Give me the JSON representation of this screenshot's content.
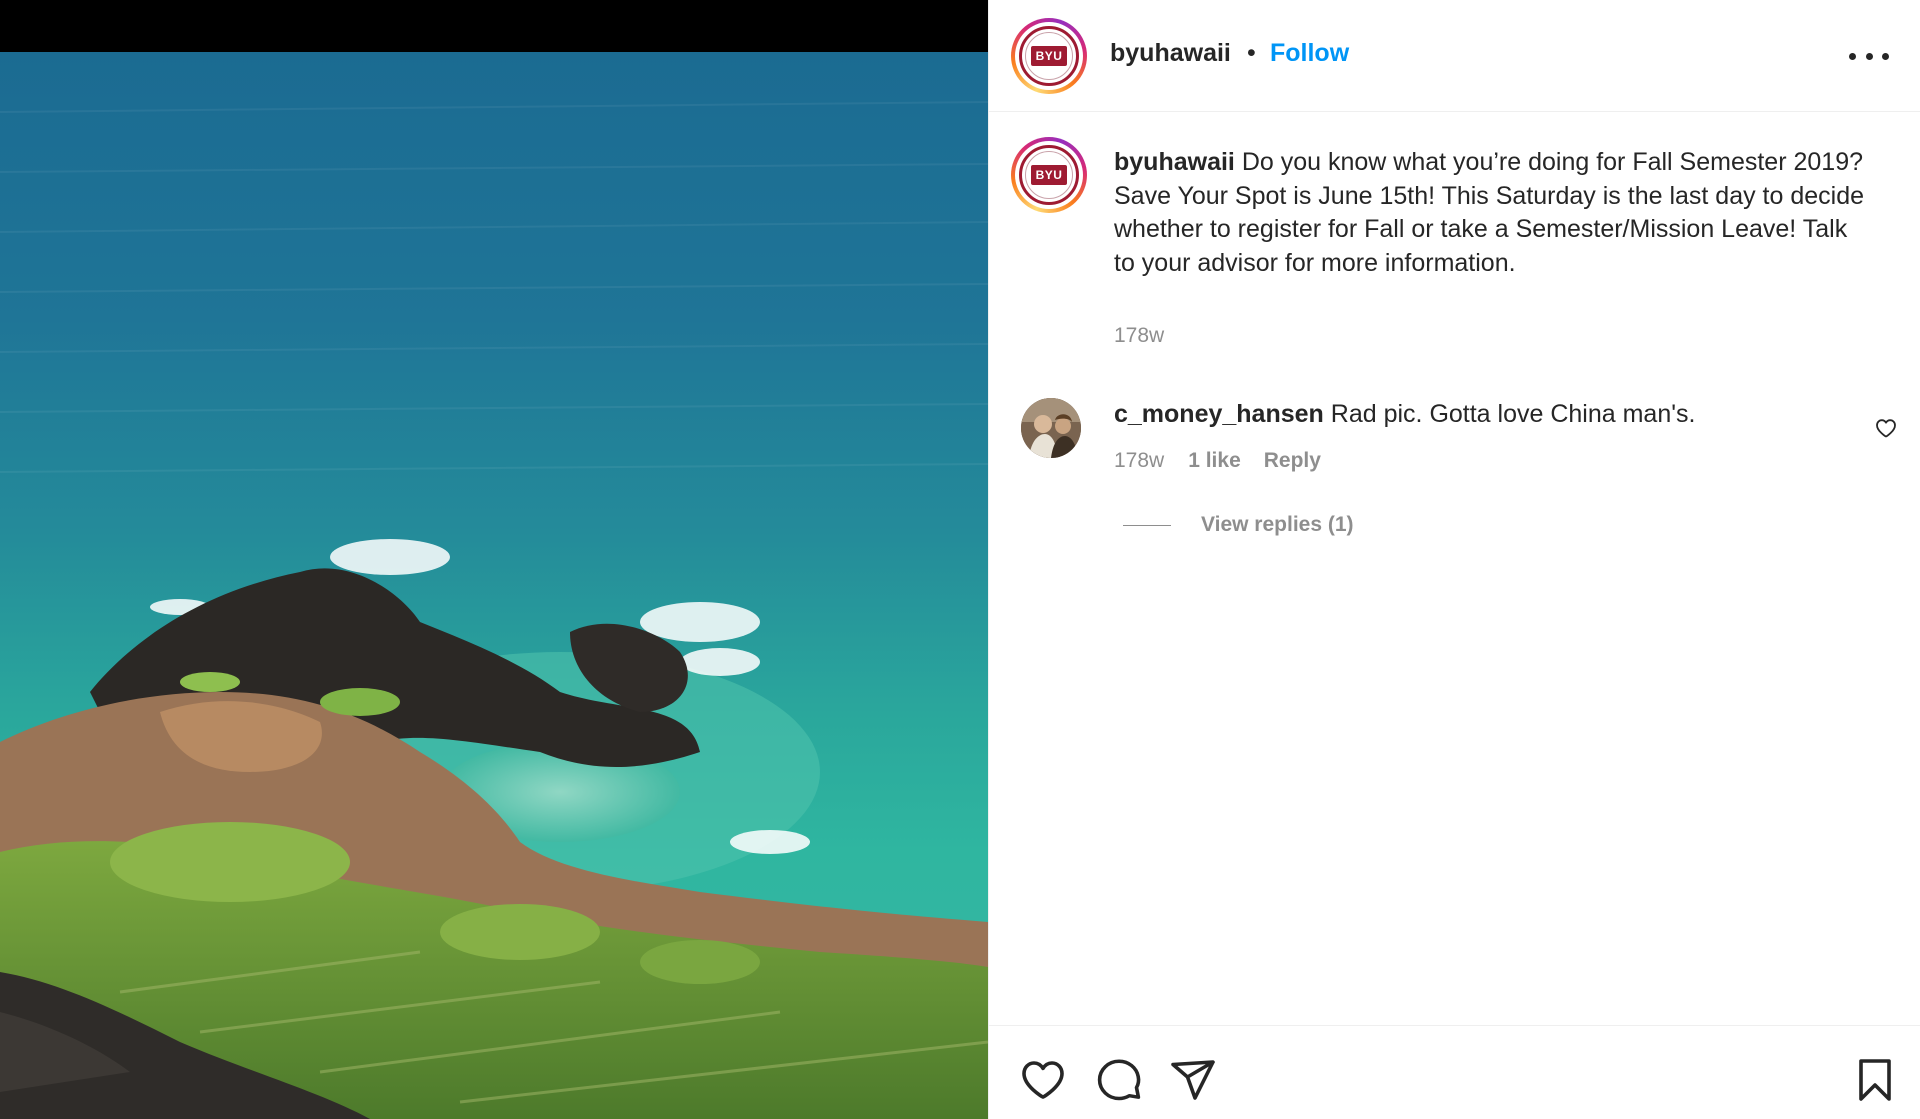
{
  "post": {
    "username": "byuhawaii",
    "separator": "•",
    "follow_label": "Follow",
    "avatar_logo_text": "BYU",
    "caption": {
      "username": "byuhawaii",
      "text": "Do you know what you’re doing for Fall Semester 2019? Save Your Spot is June 15th! This Saturday is the last day to decide whether to register for Fall or take a Semester/Mission Leave! Talk to your advisor for more information.",
      "time": "178w"
    }
  },
  "comment": {
    "username": "c_money_hansen",
    "text": "Rad pic. Gotta love China man's.",
    "time": "178w",
    "likes": "1 like",
    "reply_label": "Reply",
    "view_replies_label": "View replies (1)"
  },
  "icons": {
    "more": "more-options-icon",
    "comment_like": "heart-icon",
    "like": "heart-icon",
    "comment": "comment-icon",
    "share": "send-icon",
    "save": "bookmark-icon"
  },
  "colors": {
    "follow": "#0095f6",
    "muted": "#8e8e8e",
    "text": "#262626",
    "brand": "#9e1b32"
  }
}
